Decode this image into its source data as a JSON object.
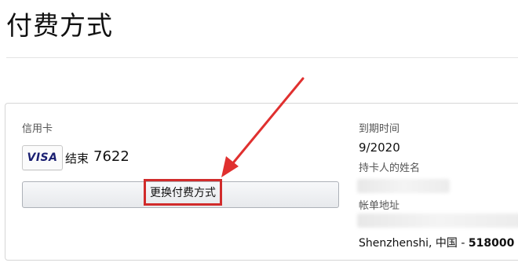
{
  "page": {
    "title": "付费方式"
  },
  "payment": {
    "type_label": "信用卡",
    "brand": "VISA",
    "ending_label": "结束",
    "card_last4": "7622",
    "change_button_label": "更换付费方式",
    "expiry_label": "到期时间",
    "expiry_value": "9/2020",
    "holder_label": "持卡人的姓名",
    "address_label": "帐单地址",
    "address_city_country": "Shenzhenshi, 中国 - ",
    "address_postcode": "518000"
  },
  "colors": {
    "highlight": "#d12b2b",
    "visa_blue": "#1a1f71",
    "text": "#111111",
    "label": "#555555",
    "border": "#d6d6d6"
  },
  "icons": {
    "arrow": "red-arrow-icon",
    "brand_logo": "visa-logo-icon"
  }
}
